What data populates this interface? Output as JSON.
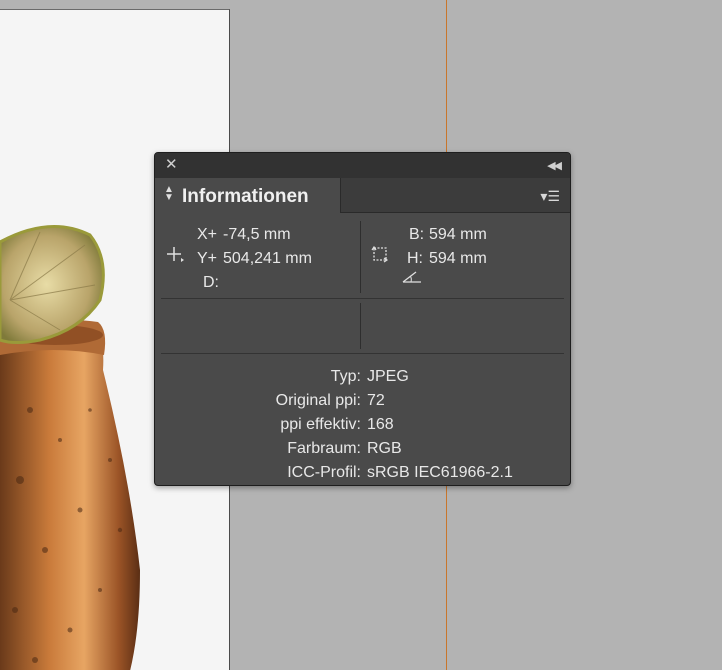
{
  "panel": {
    "tab_label": "Informationen",
    "position": {
      "x_label": "X+",
      "x_value": "-74,5 mm",
      "y_label": "Y+",
      "y_value": "504,241 mm",
      "d_label": "D:",
      "d_value": ""
    },
    "size": {
      "w_label": "B:",
      "w_value": "594 mm",
      "h_label": "H:",
      "h_value": "594 mm"
    },
    "image_info": [
      {
        "label": "Typ:",
        "value": "JPEG"
      },
      {
        "label": "Original ppi:",
        "value": "72"
      },
      {
        "label": "ppi effektiv:",
        "value": "168"
      },
      {
        "label": "Farbraum:",
        "value": "RGB"
      },
      {
        "label": "ICC-Profil:",
        "value": "sRGB IEC61966-2.1"
      }
    ]
  },
  "icons": {
    "close": "close-icon",
    "collapse": "double-chevron-left-icon",
    "tab_arrows": "up-down-arrows-icon",
    "menu": "panel-menu-icon",
    "crosshair": "crosshair-icon",
    "transform": "transform-icon",
    "angle": "angle-icon"
  },
  "colors": {
    "panel_bg": "#4a4a4a",
    "canvas_bg": "#b3b3b3",
    "guide": "#c8762c"
  }
}
